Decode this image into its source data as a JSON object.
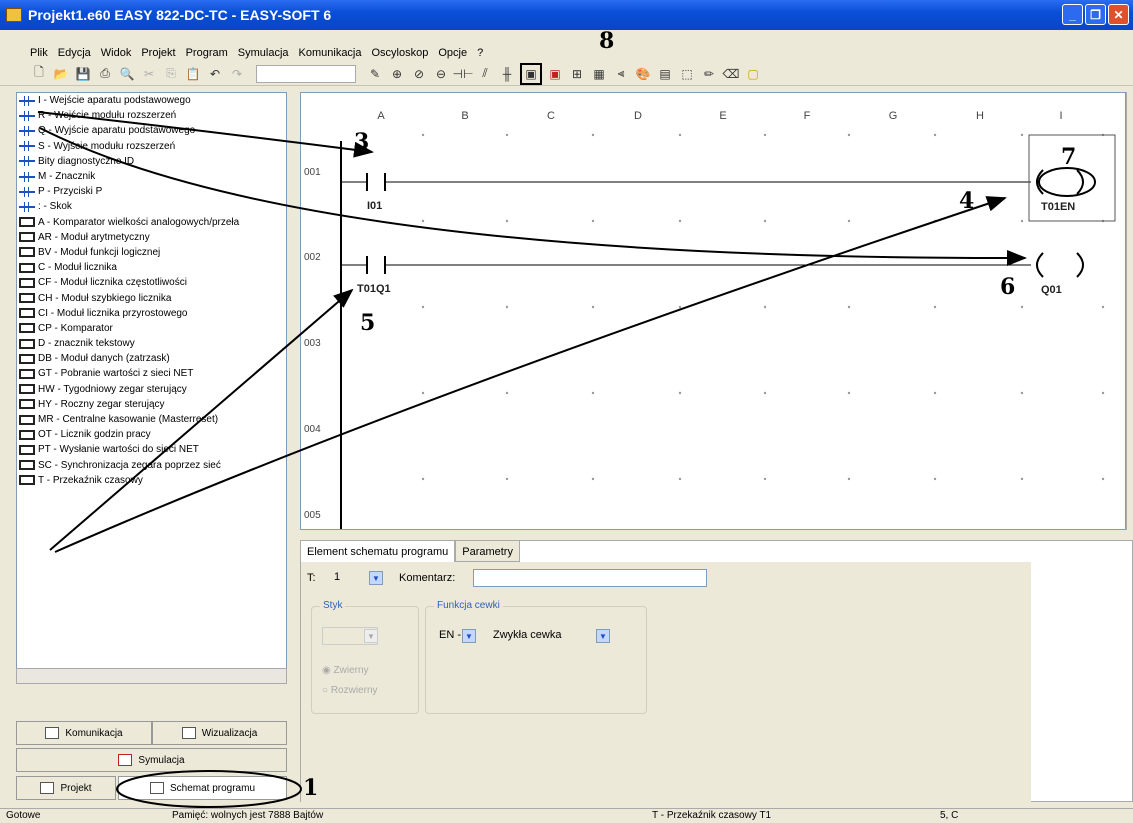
{
  "window": {
    "title": "Projekt1.e60 EASY 822-DC-TC - EASY-SOFT 6"
  },
  "menu": [
    "Plik",
    "Edycja",
    "Widok",
    "Projekt",
    "Program",
    "Symulacja",
    "Komunikacja",
    "Oscyloskop",
    "Opcje",
    "?"
  ],
  "tree": [
    {
      "icon": "contact",
      "label": "I - Wejście aparatu podstawowego"
    },
    {
      "icon": "contact",
      "label": "R - Wejście modułu rozszerzeń"
    },
    {
      "icon": "contact",
      "label": "Q - Wyjście aparatu podstawowego"
    },
    {
      "icon": "contact",
      "label": "S - Wyjście modułu rozszerzeń"
    },
    {
      "icon": "contact",
      "label": "Bity diagnostyczne ID"
    },
    {
      "icon": "contact",
      "label": "M - Znacznik"
    },
    {
      "icon": "contact",
      "label": "P - Przyciski P"
    },
    {
      "icon": "contact",
      "label": ": - Skok"
    },
    {
      "icon": "module",
      "label": "A - Komparator wielkości analogowych/przeła"
    },
    {
      "icon": "module",
      "label": "AR - Moduł arytmetyczny"
    },
    {
      "icon": "module",
      "label": "BV - Moduł funkcji logicznej"
    },
    {
      "icon": "module",
      "label": "C - Moduł licznika"
    },
    {
      "icon": "module",
      "label": "CF - Moduł licznika częstotliwości"
    },
    {
      "icon": "module",
      "label": "CH - Moduł szybkiego licznika"
    },
    {
      "icon": "module",
      "label": "CI - Moduł licznika przyrostowego"
    },
    {
      "icon": "module",
      "label": "CP - Komparator"
    },
    {
      "icon": "module",
      "label": "D - znacznik tekstowy"
    },
    {
      "icon": "module",
      "label": "DB - Moduł danych (zatrzask)"
    },
    {
      "icon": "module",
      "label": "GT - Pobranie wartości z sieci NET"
    },
    {
      "icon": "module",
      "label": "HW - Tygodniowy zegar sterujący"
    },
    {
      "icon": "module",
      "label": "HY - Roczny zegar sterujący"
    },
    {
      "icon": "module",
      "label": "MR - Centralne kasowanie (Masterreset)"
    },
    {
      "icon": "module",
      "label": "OT - Licznik godzin pracy"
    },
    {
      "icon": "module",
      "label": "PT - Wysłanie wartości do sieci NET"
    },
    {
      "icon": "module",
      "label": "SC - Synchronizacja zegara poprzez sieć"
    },
    {
      "icon": "module",
      "label": "T - Przekaźnik czasowy"
    }
  ],
  "nav": {
    "komunikacja": "Komunikacja",
    "wizualizacja": "Wizualizacja",
    "symulacja": "Symulacja",
    "projekt": "Projekt",
    "schemat": "Schemat programu"
  },
  "diagram": {
    "columns": [
      "A",
      "B",
      "C",
      "D",
      "E",
      "F",
      "G",
      "H",
      "I"
    ],
    "rows": [
      "001",
      "002",
      "003",
      "004",
      "005"
    ],
    "contacts": [
      {
        "label": "I01"
      },
      {
        "label": "T01Q1"
      }
    ],
    "coils": [
      {
        "label": "T01EN"
      },
      {
        "label": "Q01"
      }
    ]
  },
  "props": {
    "tabs": [
      "Element schematu programu",
      "Parametry"
    ],
    "t_label": "T:",
    "t_value": "1",
    "komentarz_label": "Komentarz:",
    "komentarz_value": "",
    "styk_label": "Styk",
    "funkcja_label": "Funkcja cewki",
    "en_value": "EN -",
    "cewka_value": "Zwykła cewka",
    "radio_zwierny": "Zwierny",
    "radio_rozwierny": "Rozwierny"
  },
  "status": {
    "ready": "Gotowe",
    "memory": "Pamięć: wolnych jest 7888 Bajtów",
    "element": "T - Przekaźnik czasowy T1",
    "pos": "5, C"
  },
  "annotations": [
    "1",
    "3",
    "4",
    "5",
    "6",
    "7",
    "8"
  ]
}
